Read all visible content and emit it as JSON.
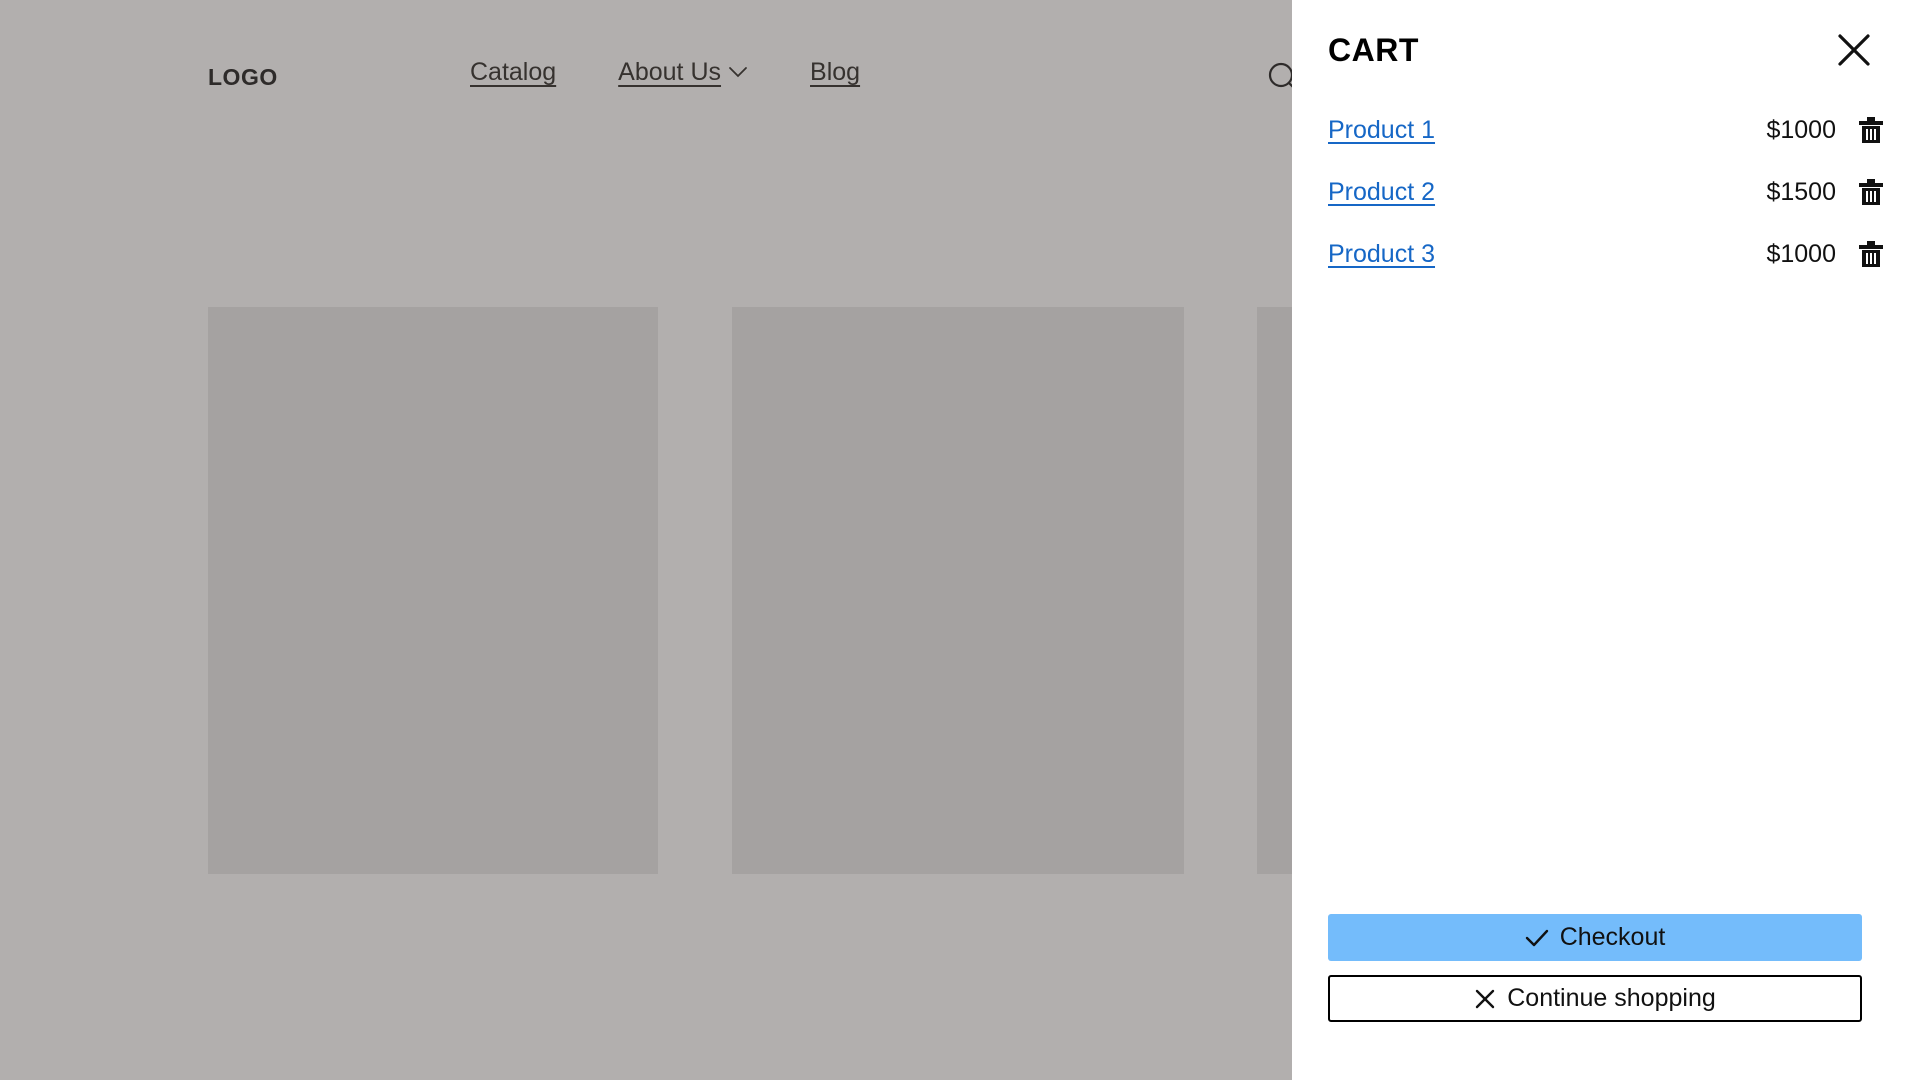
{
  "storefront": {
    "logo": "LOGO",
    "nav": [
      {
        "label": "Catalog",
        "icon": "",
        "has_chevron": false
      },
      {
        "label": "About Us",
        "icon": "chevron-down-icon",
        "has_chevron": true
      },
      {
        "label": "Blog",
        "icon": "",
        "has_chevron": false
      }
    ],
    "search_icon": "search-icon",
    "cards": [
      {
        "id": "product-card-1"
      },
      {
        "id": "product-card-2"
      },
      {
        "id": "product-card-3"
      }
    ],
    "colors": {
      "overlay_background": "#b2afae",
      "card": "#a5a2a1",
      "text": "#36322f"
    }
  },
  "cart": {
    "title": "CART",
    "close_icon": "close-icon",
    "items": [
      {
        "name": "Product 1",
        "price": "$1000",
        "remove_icon": "trash-icon"
      },
      {
        "name": "Product 2",
        "price": "$1500",
        "remove_icon": "trash-icon"
      },
      {
        "name": "Product 3",
        "price": "$1000",
        "remove_icon": "trash-icon"
      }
    ],
    "actions": {
      "checkout_label": "Checkout",
      "checkout_icon": "check-icon",
      "continue_label": "Continue shopping",
      "continue_icon": "close-icon"
    },
    "colors": {
      "panel_background": "#ffffff",
      "link": "#1667c6",
      "checkout_button": "#74bcfb",
      "border": "#000000"
    }
  }
}
